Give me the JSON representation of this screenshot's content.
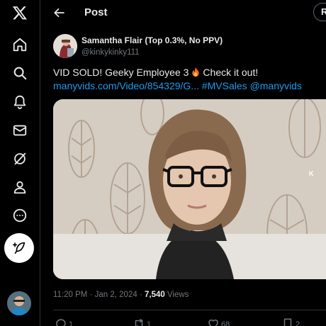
{
  "sidebar": {
    "items": [
      {
        "icon": "x-logo-icon"
      },
      {
        "icon": "home-icon"
      },
      {
        "icon": "search-icon"
      },
      {
        "icon": "bell-icon"
      },
      {
        "icon": "mail-icon"
      },
      {
        "icon": "grok-icon"
      },
      {
        "icon": "person-icon"
      },
      {
        "icon": "more-circle-icon"
      }
    ],
    "compose_icon": "feather-plus-icon"
  },
  "header": {
    "title": "Post",
    "back_icon": "arrow-left-icon",
    "reply_button_label": "R"
  },
  "post": {
    "author_name": "Samantha Flair (Top 0.3%, No PPV)",
    "author_handle": "@kinkykinky111",
    "text_line1_before": "VID SOLD! Geeky Employee 3",
    "text_line1_emoji": "fire",
    "text_line1_after": "Check it out!",
    "link_url": "manyvids.com/Video/854329/G...",
    "hashtag": "#MVSales",
    "mention": "@manyvids",
    "media_tag": "K",
    "time": "11:20 PM",
    "date_sep": "·",
    "date": "Jan 2, 2024",
    "views_sep": "·",
    "views_count": "7,540",
    "views_label": "Views"
  },
  "actions": {
    "reply_count": "1",
    "repost_count": "1",
    "like_count": "68",
    "bookmark_count": "2"
  },
  "colors": {
    "background": "#000000",
    "text": "#e7e9ea",
    "secondary": "#71767b",
    "link": "#1d9bf0",
    "border": "#2f3336"
  }
}
